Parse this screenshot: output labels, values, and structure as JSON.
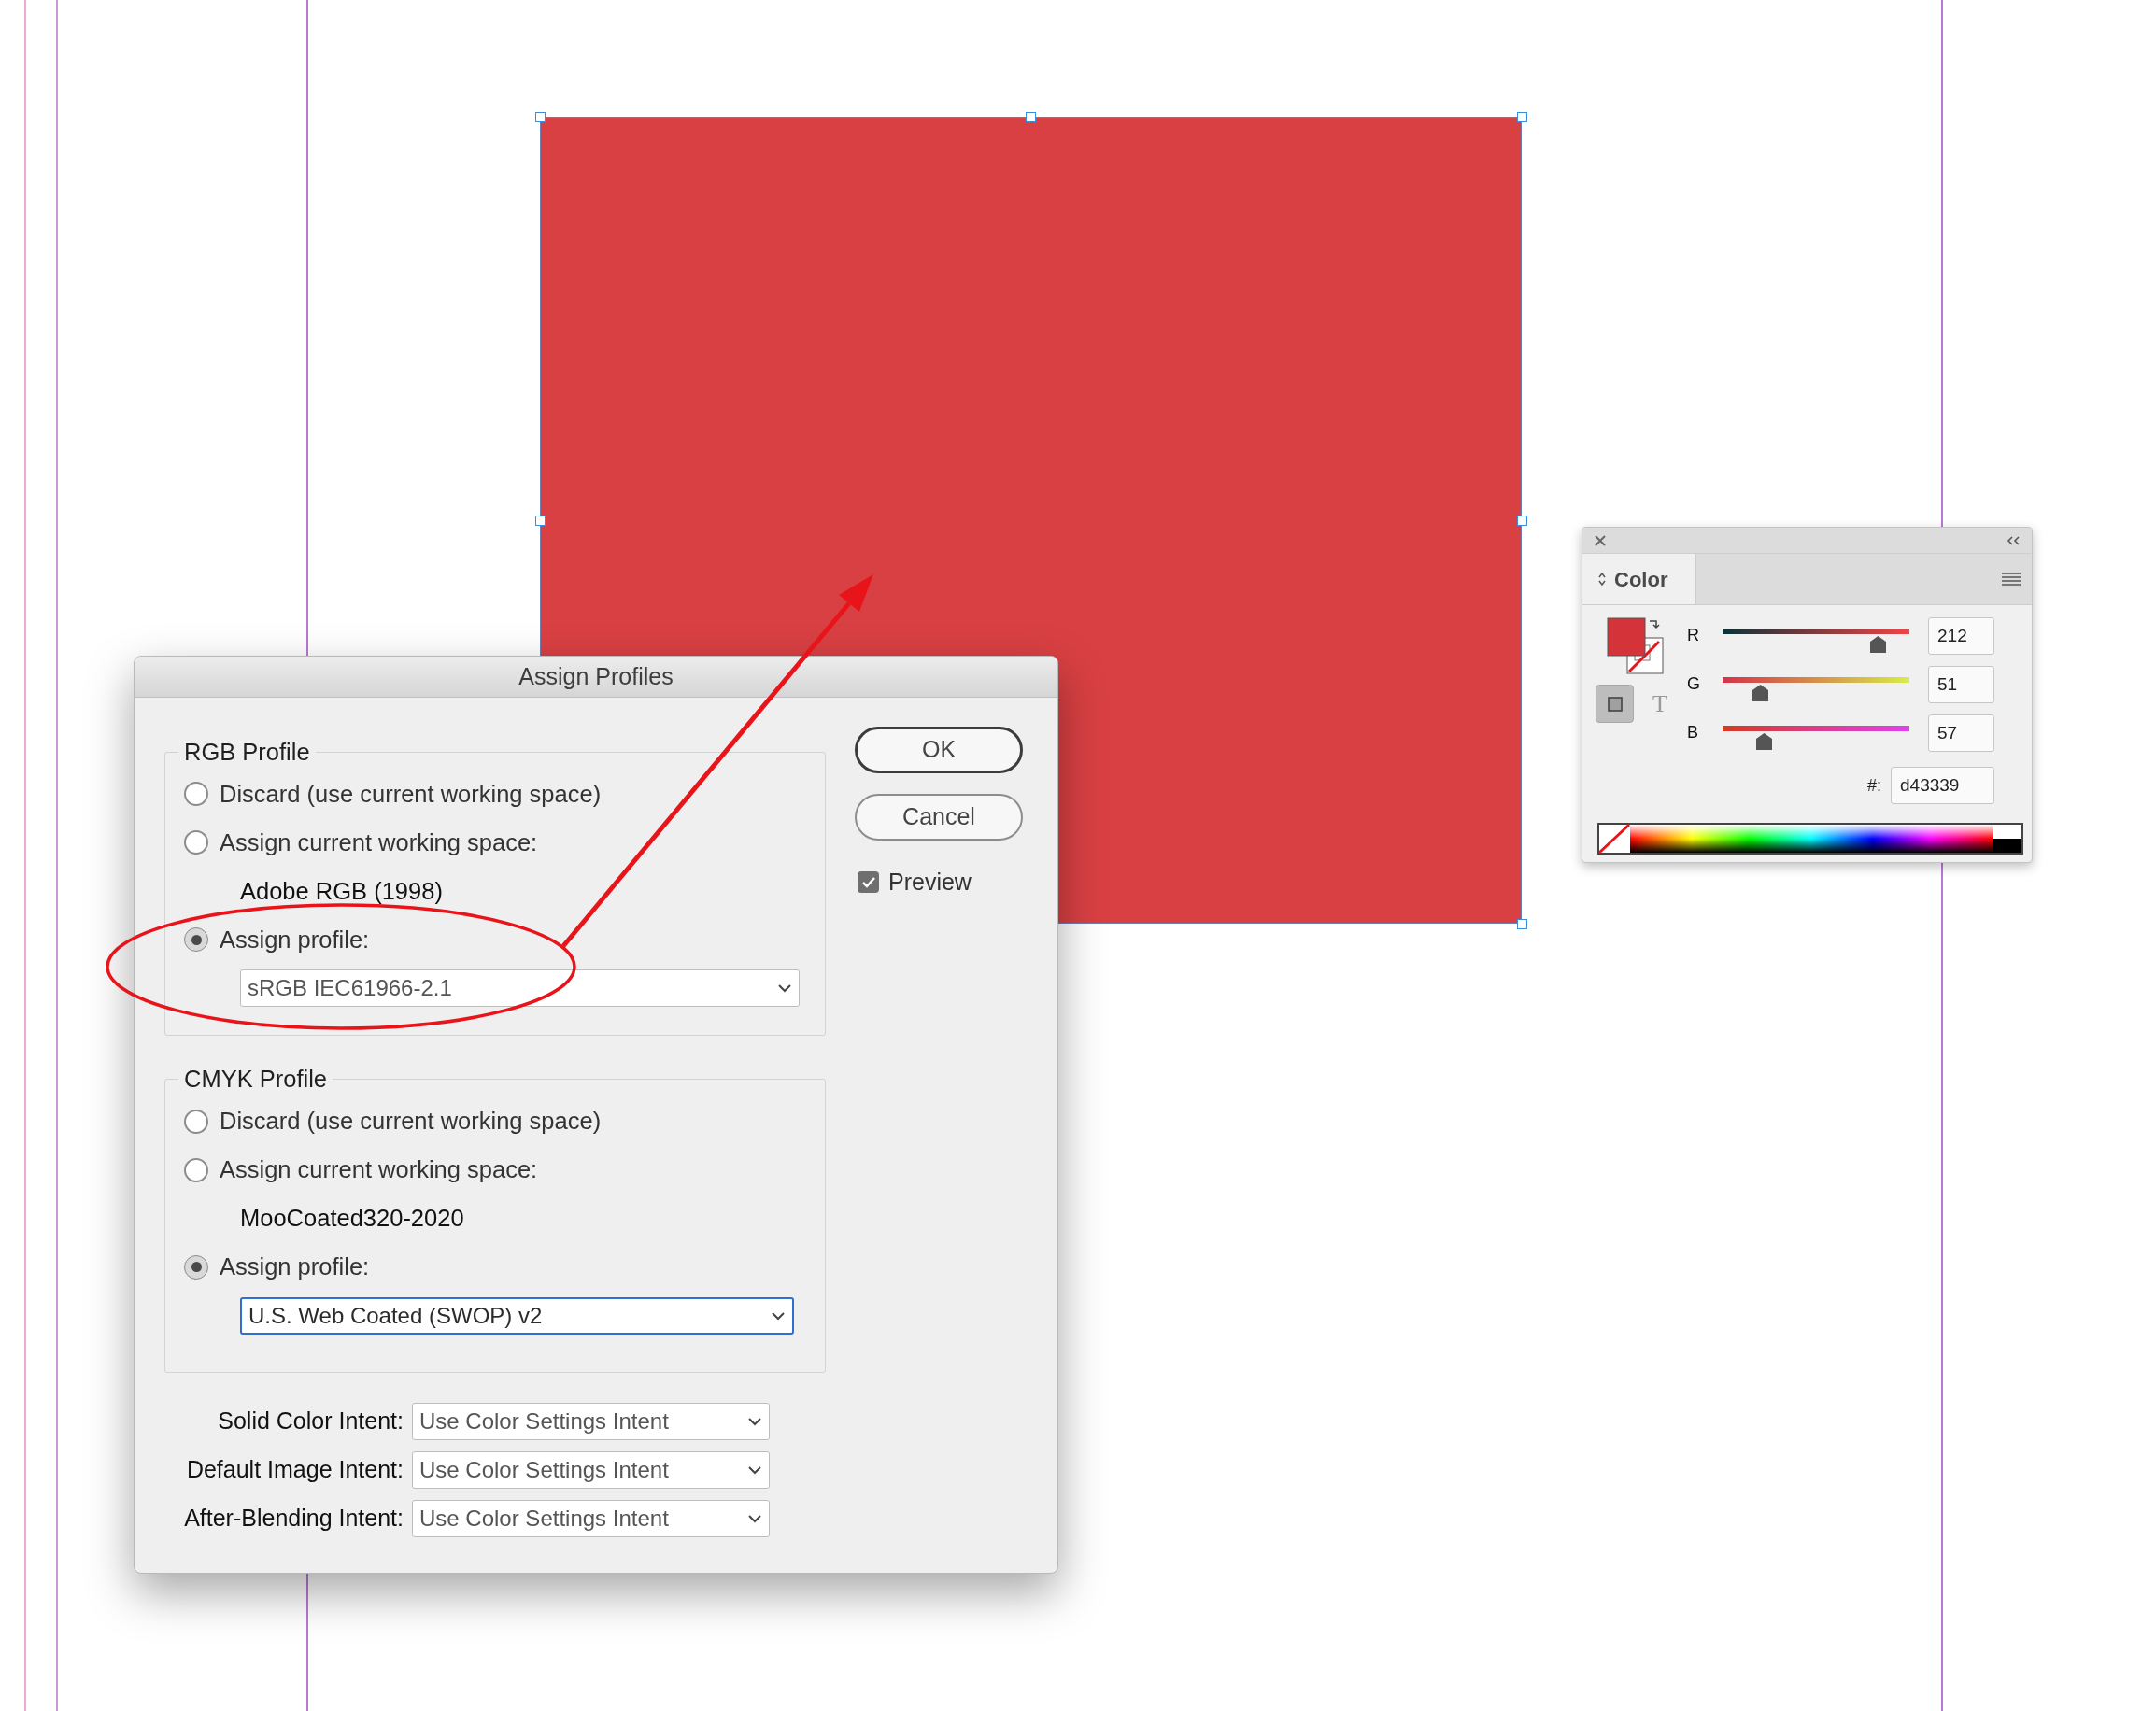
{
  "dialog": {
    "title": "Assign Profiles",
    "groups": [
      {
        "legend": "RGB Profile",
        "options": [
          {
            "label": "Discard (use current working space)",
            "selected": false
          },
          {
            "label": "Assign current working space:",
            "selected": false
          },
          {
            "label": "Assign profile:",
            "selected": true
          }
        ],
        "working_space": "Adobe RGB (1998)",
        "profile": {
          "value": "sRGB IEC61966-2.1",
          "focused": false
        }
      },
      {
        "legend": "CMYK Profile",
        "options": [
          {
            "label": "Discard (use current working space)",
            "selected": false
          },
          {
            "label": "Assign current working space:",
            "selected": false
          },
          {
            "label": "Assign profile:",
            "selected": true
          }
        ],
        "working_space": "MooCoated320-2020",
        "profile": {
          "value": "U.S. Web Coated (SWOP) v2",
          "focused": true
        }
      }
    ],
    "intents": [
      {
        "label": "Solid Color Intent:",
        "value": "Use Color Settings Intent"
      },
      {
        "label": "Default Image Intent:",
        "value": "Use Color Settings Intent"
      },
      {
        "label": "After-Blending Intent:",
        "value": "Use Color Settings Intent"
      }
    ],
    "buttons": [
      {
        "label": "OK",
        "default": true
      },
      {
        "label": "Cancel",
        "default": false
      }
    ],
    "preview": {
      "label": "Preview",
      "checked": true
    }
  },
  "color_panel": {
    "tab": "Color",
    "type_toggle": "T",
    "channels": [
      {
        "name": "R",
        "level": 0.83,
        "value": "212"
      },
      {
        "name": "G",
        "level": 0.2,
        "value": "51"
      },
      {
        "name": "B",
        "level": 0.22,
        "value": "57"
      }
    ],
    "hex_label": "#:",
    "hex": "d43339"
  }
}
